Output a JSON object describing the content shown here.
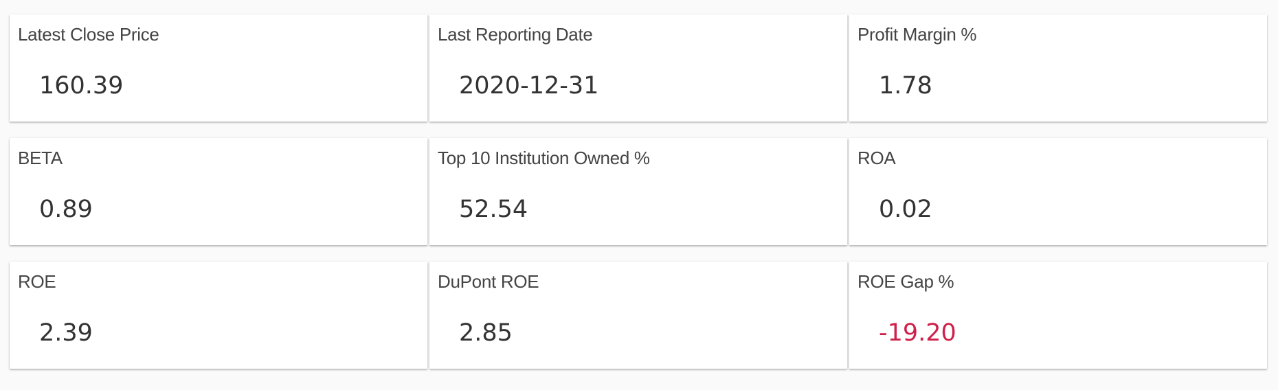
{
  "cards": [
    {
      "title": "Latest Close Price",
      "value": "160.39"
    },
    {
      "title": "Last Reporting Date",
      "value": "2020-12-31"
    },
    {
      "title": "Profit Margin %",
      "value": "1.78"
    },
    {
      "title": "BETA",
      "value": "0.89"
    },
    {
      "title": "Top 10 Institution Owned %",
      "value": "52.54"
    },
    {
      "title": "ROA",
      "value": "0.02"
    },
    {
      "title": "ROE",
      "value": "2.39"
    },
    {
      "title": "DuPont ROE",
      "value": "2.85"
    },
    {
      "title": "ROE Gap %",
      "value": "-19.20"
    }
  ],
  "colors": {
    "negative_value": "#d0204a",
    "value_text": "#333333",
    "title_text": "#444444"
  }
}
